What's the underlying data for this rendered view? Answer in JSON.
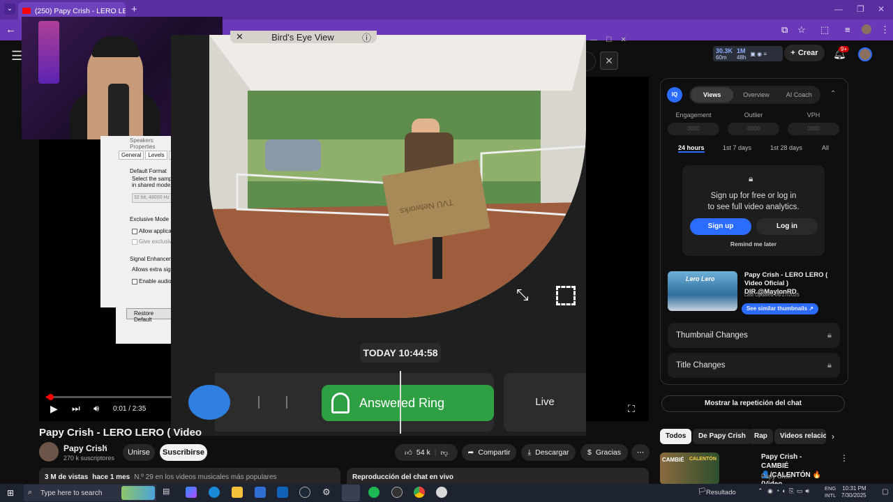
{
  "browser": {
    "tab_title": "(250) Papy Crish - LERO LERO (",
    "tab_close": "✕",
    "new_tab": "+"
  },
  "youtube_header": {
    "stats_subs": "30.3K",
    "stats_subs_sub": "60m",
    "stats_views": "1M",
    "stats_views_sub": "48h",
    "create_label": "Crear",
    "notif_badge": "9+"
  },
  "player": {
    "time": "0:01 / 2:35",
    "progress": 0.006
  },
  "dialog": {
    "title": "Speakers Properties",
    "tabs": [
      "General",
      "Levels",
      "Ad"
    ],
    "default_format": "Default Format",
    "select_text_1": "Select the sampl",
    "select_text_2": "in shared mode.",
    "format_value": "32 bit, 48000 Hz",
    "exclusive_mode": "Exclusive Mode",
    "allow_apps": "Allow applica",
    "give_exclusive": "Give exclusiv",
    "signal_enh": "Signal Enhancem",
    "allows_extra": "Allows extra sig",
    "enable_audio": "Enable audio",
    "restore_default": "Restore Default"
  },
  "ring": {
    "view_title": "Bird's Eye View",
    "box_text": "TVU Networks",
    "timestamp": "TODAY 10:44:58",
    "event_label": "Answered Ring",
    "live_label": "Live"
  },
  "video": {
    "title": "Papy Crish - LERO LERO ( Video",
    "channel": "Papy Crish",
    "subscribers": "270 k suscriptores",
    "join": "Unirse",
    "subscribe": "Suscribirse",
    "likes": "54 k",
    "share": "Compartir",
    "download": "Descargar",
    "thanks": "Gracias",
    "views": "3 M de vistas",
    "age": "hace 1 mes",
    "ranking": "N.º 29 en los videos musicales más populares",
    "chat_replay_header": "Reproducción del chat en vivo"
  },
  "vidiq": {
    "logo": "IQ",
    "tabs": [
      "Views",
      "Overview",
      "AI Coach"
    ],
    "metrics": [
      "Engagement",
      "Outlier",
      "VPH"
    ],
    "blurred": "0000",
    "ranges": [
      "24 hours",
      "1st 7 days",
      "1st 28 days",
      "All"
    ],
    "lock_msg_1": "Sign up for free or log in",
    "lock_msg_2": "to see full video analytics.",
    "signup": "Sign up",
    "login": "Log in",
    "remind": "Remind me later",
    "thumb_title": "Papy Crish - LERO LERO ( Video Oficial ) DIR.@MaylonRD",
    "updated": "Last Updated 06/17/2025",
    "similar": "See similar thumbnails ↗",
    "thumbnail_changes": "Thumbnail Changes",
    "title_changes": "Title Changes",
    "thumb_overlay": "Lero Lero"
  },
  "sidebar": {
    "chat_replay_button": "Mostrar la repetición del chat",
    "chips": [
      "Todos",
      "De Papy Crish",
      "Rap",
      "Videos relacio"
    ],
    "rec_title": "Papy Crish - CAMBIÉ 👤/CALENTÓN 🔥 (Video ...",
    "rec_channel": "Papy Crish",
    "rec_thumb_left": "CAMBIÉ",
    "rec_thumb_right": "CALENTÓN"
  },
  "taskbar": {
    "search_placeholder": "Type here to search",
    "weather": "Resultado",
    "lang_1": "ENG",
    "lang_2": "INTL",
    "time": "10:31 PM",
    "date": "7/30/2025"
  },
  "colors": {
    "browser_purple": "#5b2ea0",
    "yt_red": "#ff0000",
    "ring_green": "#2ea043",
    "vidiq_blue": "#2b6cff"
  }
}
